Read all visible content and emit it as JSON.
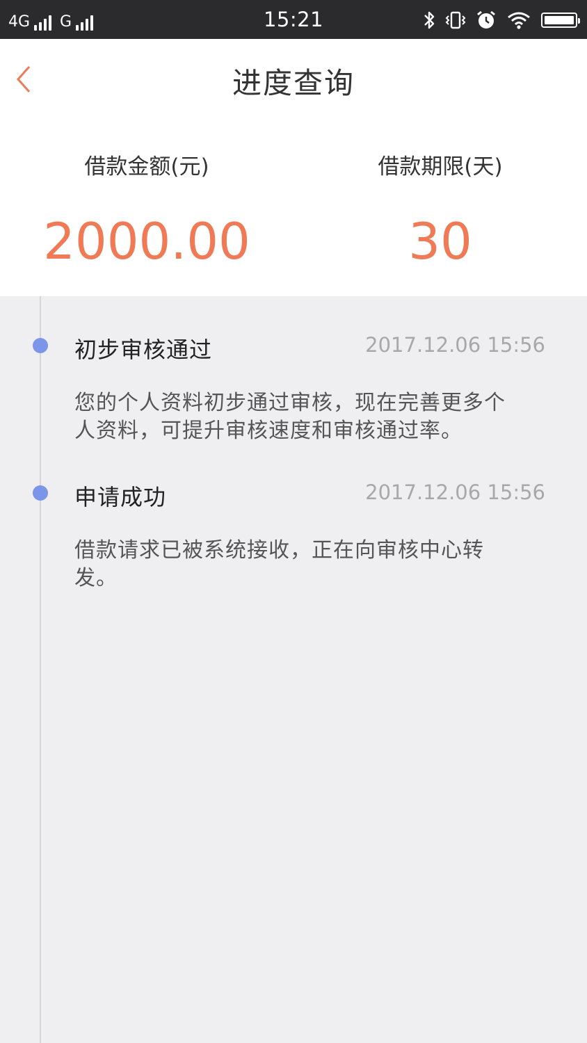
{
  "status_bar": {
    "network_1": "4G",
    "network_2": "G",
    "time": "15:21",
    "icons": [
      "bluetooth-icon",
      "vibrate-icon",
      "alarm-icon",
      "wifi-icon",
      "battery-icon"
    ],
    "battery_level": 1.0
  },
  "header": {
    "title": "进度查询",
    "back_icon": "chevron-left-icon",
    "accent_color": "#ef7a55"
  },
  "loan": {
    "amount_label": "借款金额(元)",
    "amount_value": "2000.00",
    "term_label": "借款期限(天)",
    "term_value": "30"
  },
  "timeline": {
    "dot_color": "#7b96e8",
    "events": [
      {
        "title": "初步审核通过",
        "time": "2017.12.06 15:56",
        "desc_line1": "您的个人资料初步通过审核，现在完善更多个",
        "desc_line2": "人资料，可提升审核速度和审核通过率。"
      },
      {
        "title": "申请成功",
        "time": "2017.12.06 15:56",
        "desc_line1": "借款请求已被系统接收，正在向审核中心转",
        "desc_line2": "发。"
      }
    ]
  }
}
